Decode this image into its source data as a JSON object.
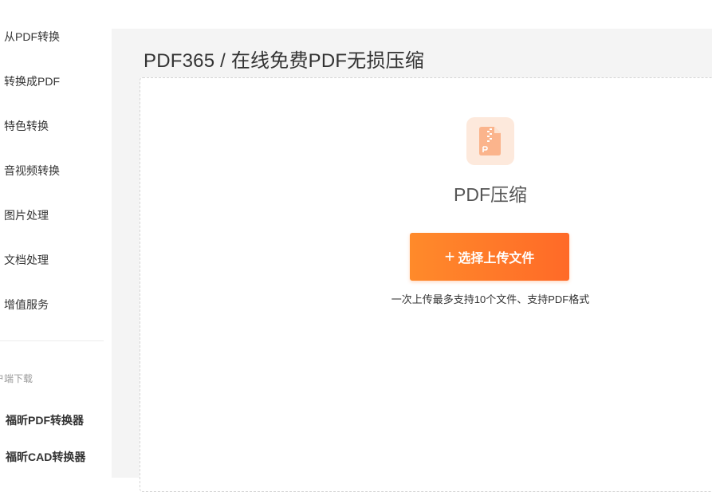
{
  "sidebar": {
    "nav_items": [
      {
        "label": "从PDF转换"
      },
      {
        "label": "转换成PDF"
      },
      {
        "label": "特色转换"
      },
      {
        "label": "音视频转换"
      },
      {
        "label": "图片处理"
      },
      {
        "label": "文档处理"
      },
      {
        "label": "增值服务"
      }
    ],
    "download_section_label": "户端下载",
    "downloads": [
      {
        "label": "福昕PDF转换器"
      },
      {
        "label": "福昕CAD转换器"
      }
    ]
  },
  "main": {
    "page_title": "PDF365 / 在线免费PDF无损压缩",
    "tool_name": "PDF压缩",
    "tool_icon": "pdf-zip-file-icon",
    "upload_button": {
      "icon": "plus-icon",
      "icon_glyph": "+",
      "label": "选择上传文件"
    },
    "upload_hint": "一次上传最多支持10个文件、支持PDF格式"
  },
  "colors": {
    "accent": "#ff7a2a",
    "icon_bg": "#fde9dc",
    "icon_fg": "#fbb48c",
    "content_bg": "#f4f4f4"
  }
}
